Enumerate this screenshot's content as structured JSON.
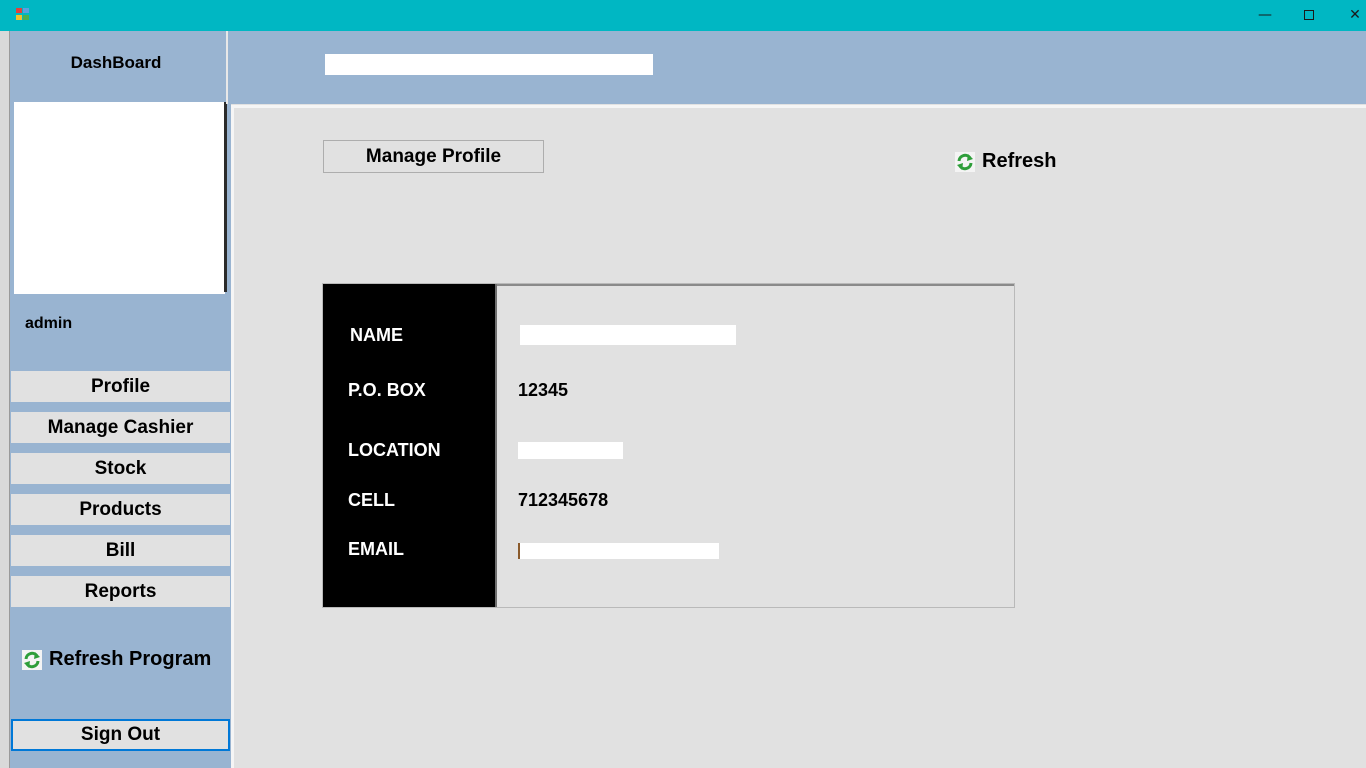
{
  "window": {
    "minimize_glyph": "—",
    "close_glyph": "✕"
  },
  "sidebar": {
    "title": "DashBoard",
    "user": "admin",
    "nav": [
      {
        "label": "Profile"
      },
      {
        "label": "Manage Cashier"
      },
      {
        "label": "Stock"
      },
      {
        "label": "Products"
      },
      {
        "label": "Bill"
      },
      {
        "label": "Reports"
      }
    ],
    "refresh_program": "Refresh Program",
    "sign_out": "Sign Out"
  },
  "main": {
    "manage_profile": "Manage Profile",
    "refresh": "Refresh"
  },
  "profile": {
    "labels": {
      "name": "NAME",
      "po_box": "P.O. BOX",
      "location": "LOCATION",
      "cell": "CELL",
      "email": "EMAIL"
    },
    "values": {
      "po_box": "12345",
      "cell": "712345678"
    }
  },
  "colors": {
    "titlebar": "#00b7c3",
    "panel": "#99b4d1",
    "surface": "#e1e1e1",
    "accent_border": "#0078d7"
  },
  "icons": {
    "app": "app-icon",
    "refresh": "refresh-icon"
  }
}
